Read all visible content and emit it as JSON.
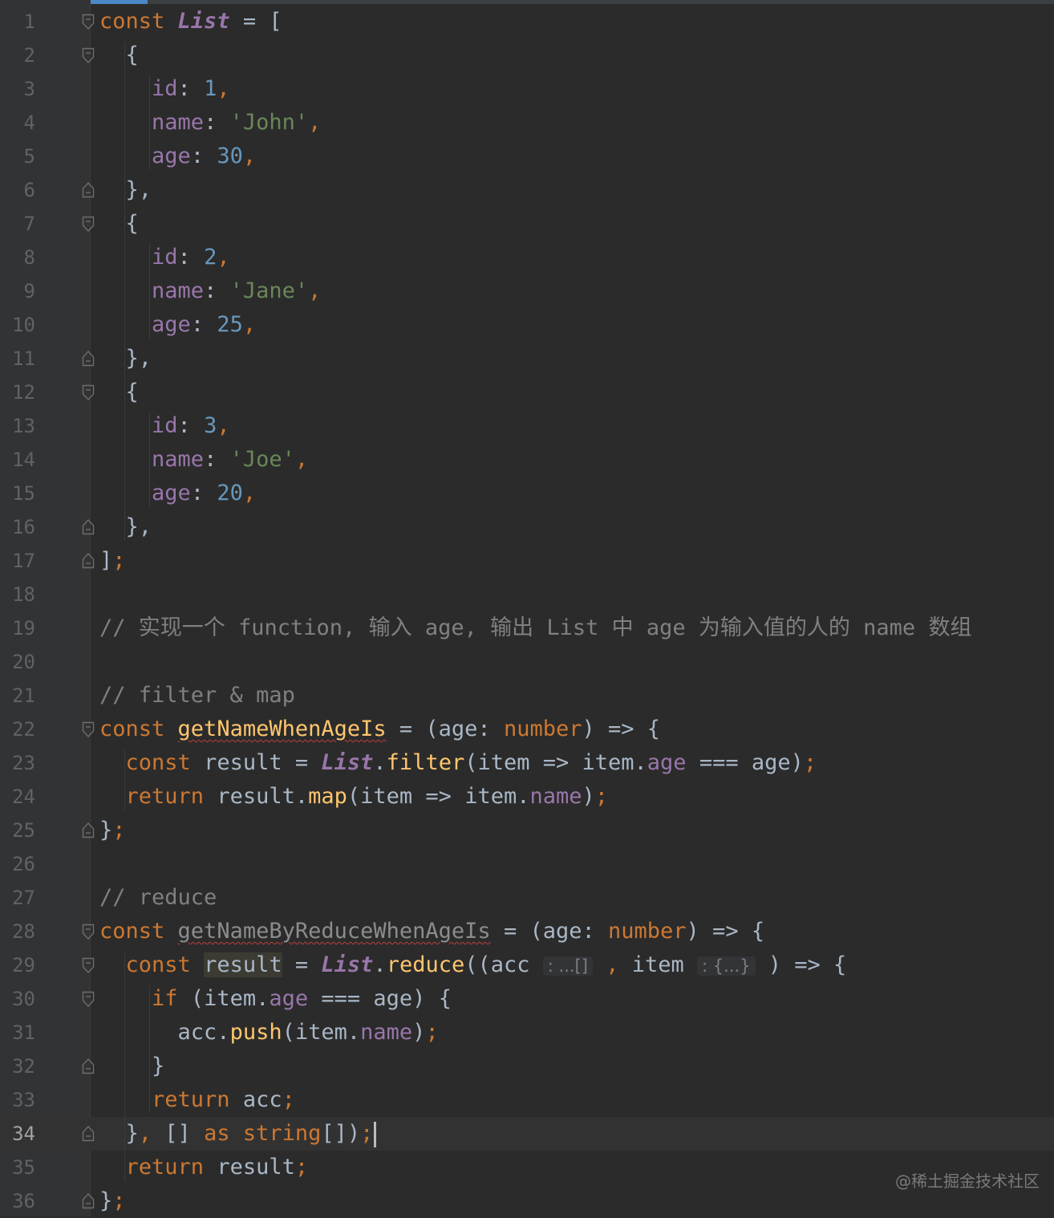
{
  "editor": {
    "current_line": "34",
    "lines": [
      {
        "n": "1",
        "tokens": [
          [
            "kw",
            "const "
          ],
          [
            "cst",
            "List"
          ],
          [
            "t",
            " = ["
          ]
        ]
      },
      {
        "n": "2",
        "tokens": [
          [
            "t",
            "  {"
          ]
        ]
      },
      {
        "n": "3",
        "tokens": [
          [
            "t",
            "    "
          ],
          [
            "prop",
            "id"
          ],
          [
            "t",
            ": "
          ],
          [
            "num",
            "1"
          ],
          [
            "kw",
            ","
          ]
        ]
      },
      {
        "n": "4",
        "tokens": [
          [
            "t",
            "    "
          ],
          [
            "prop",
            "name"
          ],
          [
            "t",
            ": "
          ],
          [
            "str",
            "'John'"
          ],
          [
            "kw",
            ","
          ]
        ]
      },
      {
        "n": "5",
        "tokens": [
          [
            "t",
            "    "
          ],
          [
            "prop",
            "age"
          ],
          [
            "t",
            ": "
          ],
          [
            "num",
            "30"
          ],
          [
            "kw",
            ","
          ]
        ]
      },
      {
        "n": "6",
        "tokens": [
          [
            "t",
            "  },"
          ]
        ]
      },
      {
        "n": "7",
        "tokens": [
          [
            "t",
            "  {"
          ]
        ]
      },
      {
        "n": "8",
        "tokens": [
          [
            "t",
            "    "
          ],
          [
            "prop",
            "id"
          ],
          [
            "t",
            ": "
          ],
          [
            "num",
            "2"
          ],
          [
            "kw",
            ","
          ]
        ]
      },
      {
        "n": "9",
        "tokens": [
          [
            "t",
            "    "
          ],
          [
            "prop",
            "name"
          ],
          [
            "t",
            ": "
          ],
          [
            "str",
            "'Jane'"
          ],
          [
            "kw",
            ","
          ]
        ]
      },
      {
        "n": "10",
        "tokens": [
          [
            "t",
            "    "
          ],
          [
            "prop",
            "age"
          ],
          [
            "t",
            ": "
          ],
          [
            "num",
            "25"
          ],
          [
            "kw",
            ","
          ]
        ]
      },
      {
        "n": "11",
        "tokens": [
          [
            "t",
            "  },"
          ]
        ]
      },
      {
        "n": "12",
        "tokens": [
          [
            "t",
            "  {"
          ]
        ]
      },
      {
        "n": "13",
        "tokens": [
          [
            "t",
            "    "
          ],
          [
            "prop",
            "id"
          ],
          [
            "t",
            ": "
          ],
          [
            "num",
            "3"
          ],
          [
            "kw",
            ","
          ]
        ]
      },
      {
        "n": "14",
        "tokens": [
          [
            "t",
            "    "
          ],
          [
            "prop",
            "name"
          ],
          [
            "t",
            ": "
          ],
          [
            "str",
            "'Joe'"
          ],
          [
            "kw",
            ","
          ]
        ]
      },
      {
        "n": "15",
        "tokens": [
          [
            "t",
            "    "
          ],
          [
            "prop",
            "age"
          ],
          [
            "t",
            ": "
          ],
          [
            "num",
            "20"
          ],
          [
            "kw",
            ","
          ]
        ]
      },
      {
        "n": "16",
        "tokens": [
          [
            "t",
            "  },"
          ]
        ]
      },
      {
        "n": "17",
        "tokens": [
          [
            "t",
            "]"
          ],
          [
            "kw",
            ";"
          ]
        ]
      },
      {
        "n": "18",
        "tokens": []
      },
      {
        "n": "19",
        "tokens": [
          [
            "cmt",
            "// 实现一个 function, 输入 age, 输出 List 中 age 为输入值的人的 name 数组"
          ]
        ]
      },
      {
        "n": "20",
        "tokens": []
      },
      {
        "n": "21",
        "tokens": [
          [
            "cmt",
            "// filter & map"
          ]
        ]
      },
      {
        "n": "22",
        "tokens": [
          [
            "kw",
            "const "
          ],
          [
            "fn squig",
            "getNameWhenAgeIs"
          ],
          [
            "t",
            " = (age: "
          ],
          [
            "kw",
            "number"
          ],
          [
            "t",
            ") => {"
          ]
        ]
      },
      {
        "n": "23",
        "tokens": [
          [
            "t",
            "  "
          ],
          [
            "kw",
            "const "
          ],
          [
            "t",
            "result = "
          ],
          [
            "cst",
            "List"
          ],
          [
            "t",
            "."
          ],
          [
            "fn",
            "filter"
          ],
          [
            "t",
            "(item => item."
          ],
          [
            "prop",
            "age"
          ],
          [
            "t",
            " === age)"
          ],
          [
            "kw",
            ";"
          ]
        ]
      },
      {
        "n": "24",
        "tokens": [
          [
            "t",
            "  "
          ],
          [
            "kw",
            "return "
          ],
          [
            "t",
            "result."
          ],
          [
            "fn",
            "map"
          ],
          [
            "t",
            "(item => item."
          ],
          [
            "prop",
            "name"
          ],
          [
            "t",
            ")"
          ],
          [
            "kw",
            ";"
          ]
        ]
      },
      {
        "n": "25",
        "tokens": [
          [
            "t",
            "}"
          ],
          [
            "kw",
            ";"
          ]
        ]
      },
      {
        "n": "26",
        "tokens": []
      },
      {
        "n": "27",
        "tokens": [
          [
            "cmt",
            "// reduce"
          ]
        ]
      },
      {
        "n": "28",
        "tokens": [
          [
            "kw",
            "const "
          ],
          [
            "unused squig",
            "getNameByReduceWhenAgeIs"
          ],
          [
            "t",
            " = (age: "
          ],
          [
            "kw",
            "number"
          ],
          [
            "t",
            ") => {"
          ]
        ]
      },
      {
        "n": "29",
        "tokens": [
          [
            "t",
            "  "
          ],
          [
            "kw",
            "const "
          ],
          [
            "hl",
            "result"
          ],
          [
            "t",
            " = "
          ],
          [
            "cst",
            "List"
          ],
          [
            "t",
            "."
          ],
          [
            "fn",
            "reduce"
          ],
          [
            "t",
            "((acc "
          ],
          [
            "hint",
            ": ...[]"
          ],
          [
            "kw",
            " ,"
          ],
          [
            "t",
            " item "
          ],
          [
            "hint",
            ": {...}"
          ],
          [
            "t",
            " ) => {"
          ]
        ]
      },
      {
        "n": "30",
        "tokens": [
          [
            "t",
            "    "
          ],
          [
            "kw",
            "if "
          ],
          [
            "t",
            "(item."
          ],
          [
            "prop",
            "age"
          ],
          [
            "t",
            " === age) {"
          ]
        ]
      },
      {
        "n": "31",
        "tokens": [
          [
            "t",
            "      acc."
          ],
          [
            "fn",
            "push"
          ],
          [
            "t",
            "(item."
          ],
          [
            "prop",
            "name"
          ],
          [
            "t",
            ")"
          ],
          [
            "kw",
            ";"
          ]
        ]
      },
      {
        "n": "32",
        "tokens": [
          [
            "t",
            "    }"
          ]
        ]
      },
      {
        "n": "33",
        "tokens": [
          [
            "t",
            "    "
          ],
          [
            "kw",
            "return "
          ],
          [
            "t",
            "acc"
          ],
          [
            "kw",
            ";"
          ]
        ]
      },
      {
        "n": "34",
        "tokens": [
          [
            "t",
            "  }"
          ],
          [
            "kw",
            ","
          ],
          [
            "t",
            " [] "
          ],
          [
            "kw",
            "as string"
          ],
          [
            "t",
            "[])"
          ],
          [
            "kw",
            ";"
          ],
          [
            "caret",
            ""
          ]
        ]
      },
      {
        "n": "35",
        "tokens": [
          [
            "t",
            "  "
          ],
          [
            "kw",
            "return "
          ],
          [
            "t",
            "result"
          ],
          [
            "kw",
            ";"
          ]
        ]
      },
      {
        "n": "36",
        "tokens": [
          [
            "t",
            "}"
          ],
          [
            "kw",
            ";"
          ]
        ]
      }
    ],
    "folds": {
      "1": "open",
      "2": "open",
      "6": "close",
      "7": "open",
      "11": "close",
      "12": "open",
      "16": "close",
      "17": "close",
      "22": "open",
      "25": "close",
      "28": "open",
      "29": "open",
      "30": "open",
      "32": "close",
      "34": "close",
      "36": "close"
    }
  },
  "watermark": "@稀土掘金技术社区",
  "colors": {
    "background": "#2b2b2b",
    "keyword": "#cc7832",
    "property": "#9876aa",
    "number": "#6897bb",
    "string": "#6a8759",
    "comment": "#808080",
    "function": "#ffc66d",
    "text": "#a9b7c6"
  }
}
